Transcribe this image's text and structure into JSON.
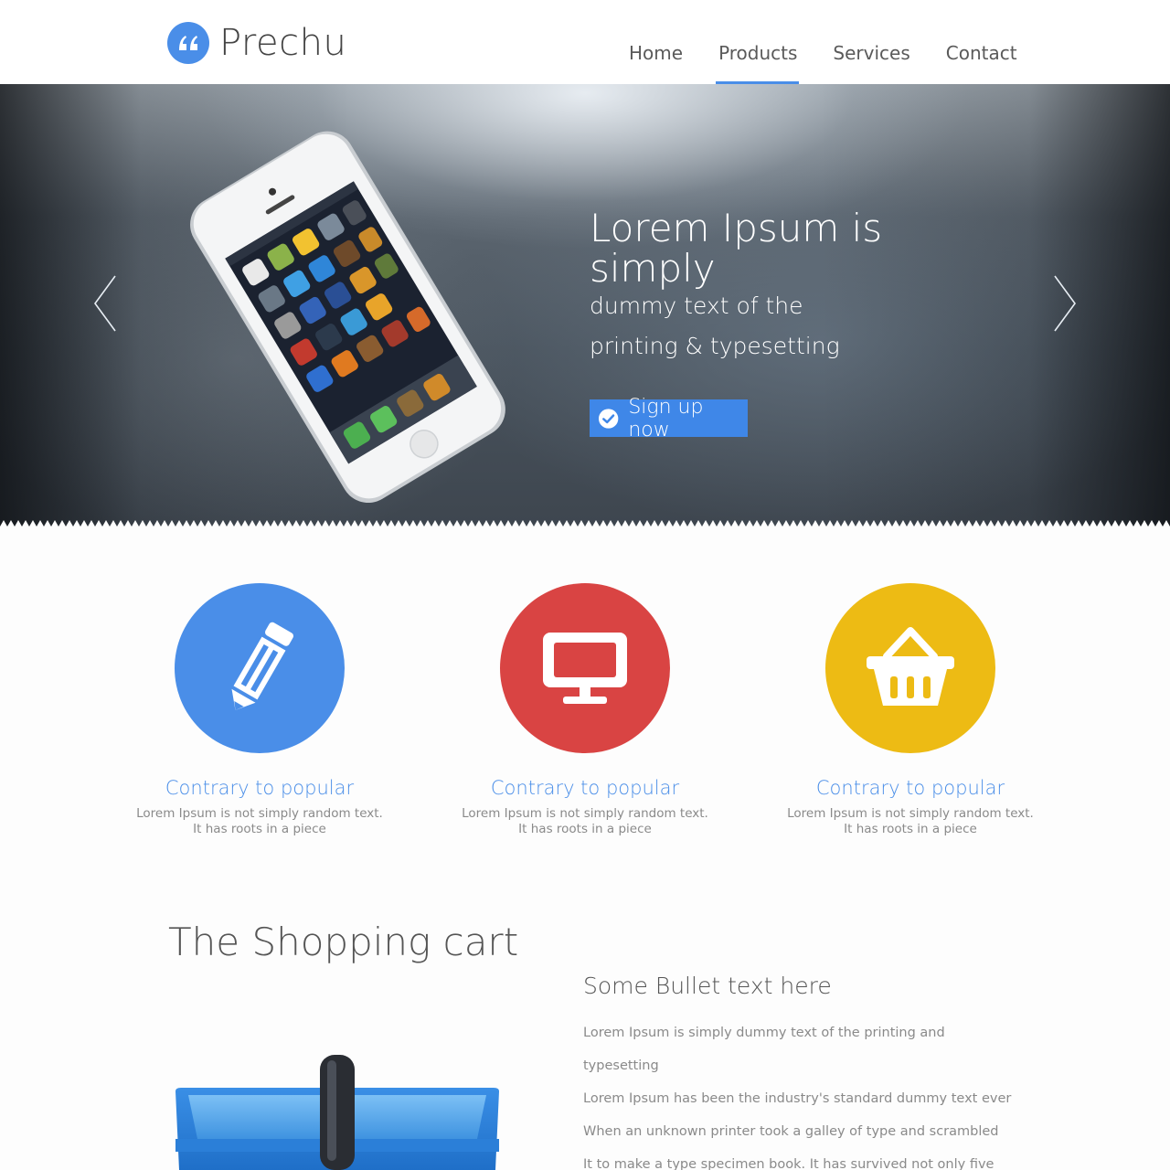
{
  "brand": {
    "name": "Prechu",
    "logo_icon": "quote-icon",
    "accent": "#4a8ee8"
  },
  "nav": {
    "items": [
      {
        "label": "Home",
        "active": false
      },
      {
        "label": "Products",
        "active": true
      },
      {
        "label": "Services",
        "active": false
      },
      {
        "label": "Contact",
        "active": false
      }
    ]
  },
  "hero": {
    "title": "Lorem Ipsum is simply",
    "subtitle_line1": "dummy text of the",
    "subtitle_line2": "printing & typesetting",
    "cta_label": "Sign up now",
    "cta_icon": "check-circle-icon",
    "prev_icon": "chevron-left-icon",
    "next_icon": "chevron-right-icon",
    "image": "smartphone-photo"
  },
  "features": [
    {
      "icon": "pencil-icon",
      "color": "#4a8ee8",
      "title": "Contrary to popular",
      "desc_line1": "Lorem Ipsum is not simply random text.",
      "desc_line2": "It has roots in a piece"
    },
    {
      "icon": "monitor-icon",
      "color": "#d94443",
      "title": "Contrary to popular",
      "desc_line1": "Lorem Ipsum is not simply random text.",
      "desc_line2": "It has roots in a piece"
    },
    {
      "icon": "basket-icon",
      "color": "#edbb14",
      "title": "Contrary to popular",
      "desc_line1": "Lorem Ipsum is not simply random text.",
      "desc_line2": "It has roots in a piece"
    }
  ],
  "cart_section": {
    "title": "The Shopping cart",
    "image": "blue-shopping-basket",
    "bullet_heading": "Some Bullet text here",
    "lines": [
      "Lorem Ipsum is simply dummy text of the printing and",
      "typesetting",
      "Lorem Ipsum has been the industry's standard dummy text ever",
      "When an unknown printer took a galley of type and scrambled",
      "It to make a type specimen book. It has survived not only five"
    ]
  }
}
